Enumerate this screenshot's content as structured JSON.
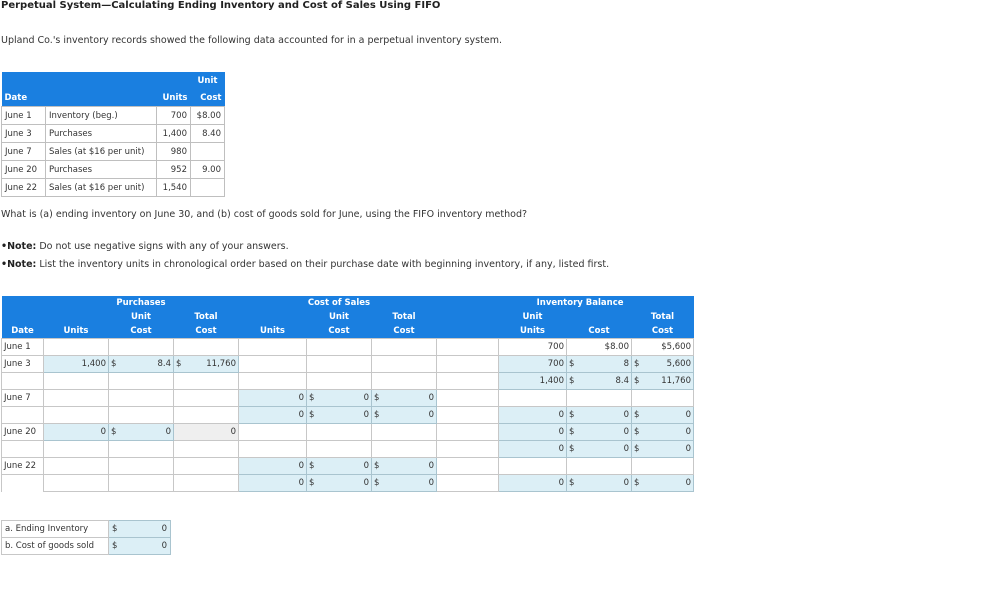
{
  "title": "Perpetual System—Calculating Ending Inventory and Cost of Sales Using FIFO",
  "intro": "Upland Co.'s inventory records showed the following data accounted for in a perpetual inventory system.",
  "data_table": {
    "headers": {
      "date": "Date",
      "units": "Units",
      "unit_top": "Unit",
      "unit_cost": "Cost"
    },
    "rows": [
      {
        "date": "June 1",
        "desc": "Inventory (beg.)",
        "units": "700",
        "cost": "$8.00"
      },
      {
        "date": "June 3",
        "desc": "Purchases",
        "units": "1,400",
        "cost": "8.40"
      },
      {
        "date": "June 7",
        "desc": "Sales (at $16 per unit)",
        "units": "980",
        "cost": ""
      },
      {
        "date": "June 20",
        "desc": "Purchases",
        "units": "952",
        "cost": "9.00"
      },
      {
        "date": "June 22",
        "desc": "Sales (at $16 per unit)",
        "units": "1,540",
        "cost": ""
      }
    ]
  },
  "question": "What is (a) ending inventory on June 30, and (b) cost of goods sold for June, using the FIFO inventory method?",
  "notes": [
    {
      "label": "•Note:",
      "text": " Do not use negative signs with any of your answers."
    },
    {
      "label": "•Note:",
      "text": " List the inventory units in chronological order based on their purchase date with beginning inventory, if any, listed first."
    }
  ],
  "fifo": {
    "group_headers": {
      "purchases": "Purchases",
      "cost_of_sales": "Cost of Sales",
      "inventory_balance": "Inventory Balance"
    },
    "col_headers": {
      "date": "Date",
      "units": "Units",
      "unit": "Unit",
      "cost": "Cost",
      "total": "Total"
    },
    "dollar": "$",
    "rows": {
      "june1": {
        "date": "June 1",
        "inv_units": "700",
        "inv_unit_cost": "$8.00",
        "inv_total": "$5,600"
      },
      "june3": {
        "date": "June 3",
        "p_units": "1,400",
        "p_unit_cost": "8.4",
        "p_total": "11,760",
        "inv1_units": "700",
        "inv1_unit_cost": "8",
        "inv1_total": "5,600",
        "inv2_units": "1,400",
        "inv2_unit_cost": "8.4",
        "inv2_total": "11,760"
      },
      "june7": {
        "date": "June 7",
        "cs1_units": "0",
        "cs1_unit_cost": "0",
        "cs1_total": "0",
        "cs2_units": "0",
        "cs2_unit_cost": "0",
        "cs2_total": "0",
        "inv_units": "0",
        "inv_unit_cost": "0",
        "inv_total": "0"
      },
      "june20": {
        "date": "June 20",
        "p_units": "0",
        "p_unit_cost": "0",
        "p_total": "0",
        "inv1_units": "0",
        "inv1_unit_cost": "0",
        "inv1_total": "0",
        "inv2_units": "0",
        "inv2_unit_cost": "0",
        "inv2_total": "0"
      },
      "june22": {
        "date": "June 22",
        "cs1_units": "0",
        "cs1_unit_cost": "0",
        "cs1_total": "0",
        "cs2_units": "0",
        "cs2_unit_cost": "0",
        "cs2_total": "0",
        "inv_units": "0",
        "inv_unit_cost": "0",
        "inv_total": "0"
      }
    }
  },
  "answers": {
    "ending_label": "a. Ending Inventory",
    "ending_value": "0",
    "cogs_label": "b. Cost of goods sold",
    "cogs_value": "0",
    "dollar": "$"
  }
}
